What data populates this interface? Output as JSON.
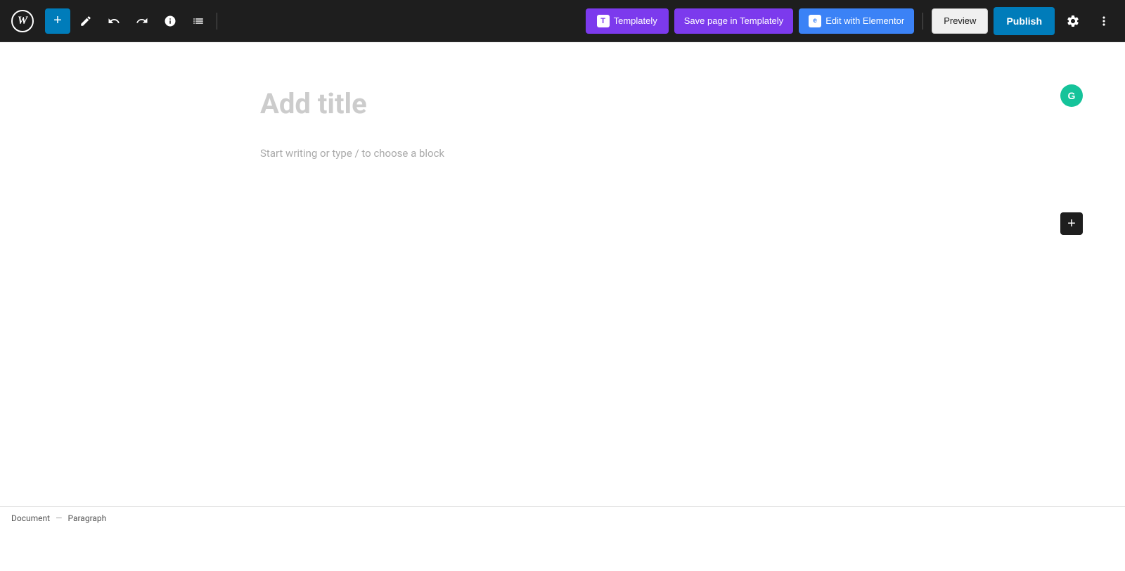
{
  "toolbar": {
    "wp_logo_label": "W",
    "add_block_label": "+",
    "undo_label": "↩",
    "redo_label": "↪",
    "info_label": "ℹ",
    "list_view_label": "≡",
    "templately_btn_label": "Templately",
    "save_templately_btn_label": "Save page in Templately",
    "elementor_btn_label": "Edit with Elementor",
    "preview_btn_label": "Preview",
    "publish_btn_label": "Publish",
    "settings_label": "⚙",
    "more_label": "⋮"
  },
  "editor": {
    "title_placeholder": "Add title",
    "block_placeholder": "Start writing or type / to choose a block"
  },
  "status_bar": {
    "document_label": "Document",
    "separator": "—",
    "paragraph_label": "Paragraph"
  },
  "icons": {
    "grammarly": "G",
    "add_block_float": "+"
  },
  "colors": {
    "wp_bg": "#1e1e1e",
    "add_block_btn": "#007cba",
    "templately_btn": "#7c3aed",
    "elementor_btn": "#3b82f6",
    "publish_btn": "#007cba",
    "grammarly_btn": "#15c39a"
  }
}
